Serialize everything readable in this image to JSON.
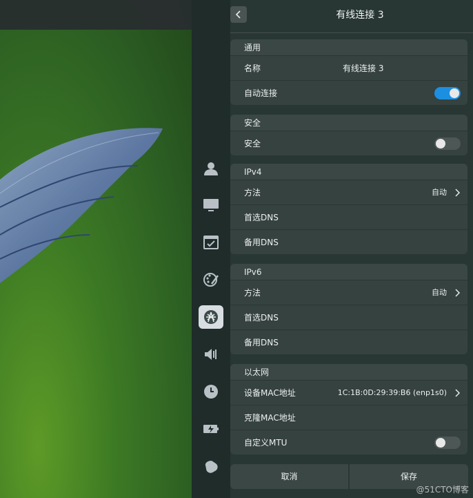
{
  "header": {
    "title": "有线连接 3"
  },
  "groups": {
    "general": {
      "heading": "通用",
      "name_label": "名称",
      "name_value": "有线连接 3",
      "auto_label": "自动连接",
      "auto_on": true
    },
    "security": {
      "heading": "安全",
      "label": "安全",
      "on": false
    },
    "ipv4": {
      "heading": "IPv4",
      "method_label": "方法",
      "method_value": "自动",
      "dns1_label": "首选DNS",
      "dns2_label": "备用DNS"
    },
    "ipv6": {
      "heading": "IPv6",
      "method_label": "方法",
      "method_value": "自动",
      "dns1_label": "首选DNS",
      "dns2_label": "备用DNS"
    },
    "ethernet": {
      "heading": "以太网",
      "mac_label": "设备MAC地址",
      "mac_value": "1C:1B:0D:29:39:B6 (enp1s0)",
      "clone_label": "克隆MAC地址",
      "mtu_label": "自定义MTU",
      "mtu_on": false
    }
  },
  "footer": {
    "cancel": "取消",
    "save": "保存"
  },
  "watermark": "@51CTO博客",
  "sidebar_icons": [
    "account-icon",
    "display-icon",
    "default-apps-icon",
    "personalization-icon",
    "network-icon",
    "sound-icon",
    "datetime-icon",
    "power-icon",
    "mouse-icon"
  ],
  "colors": {
    "accent": "#1c8fe1",
    "panel": "#283634",
    "group": "#354240"
  }
}
